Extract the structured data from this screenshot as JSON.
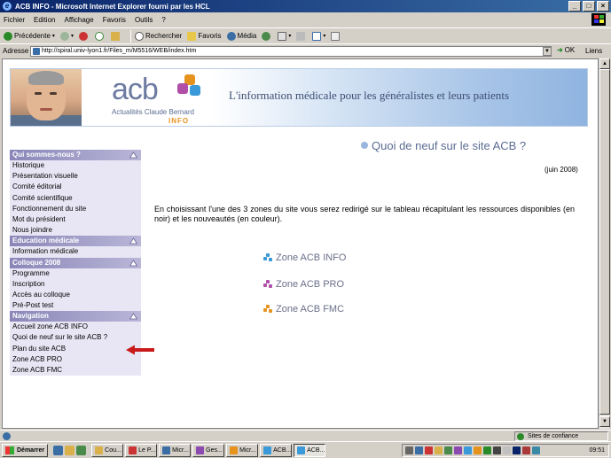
{
  "window": {
    "title": "ACB INFO - Microsoft Internet Explorer fourni par les HCL"
  },
  "menubar": [
    "Fichier",
    "Edition",
    "Affichage",
    "Favoris",
    "Outils",
    "?"
  ],
  "toolbar": {
    "back": "Précédente",
    "search": "Rechercher",
    "favorites": "Favoris",
    "media": "Média"
  },
  "address": {
    "label": "Adresse",
    "url": "http://spiral.univ-lyon1.fr/Files_m/M5516/WEB/index.htm",
    "go": "OK",
    "links": "Liens"
  },
  "banner": {
    "logo": "acb",
    "logo_sub": "Actualités Claude Bernard",
    "logo_info": "INFO",
    "tagline": "L'information médicale pour les généralistes et leurs patients"
  },
  "sidebar": {
    "sections": [
      {
        "title": "Qui sommes-nous ?",
        "items": [
          "Historique",
          "Présentation visuelle",
          "Comité éditorial",
          "Comité scientifique",
          "Fonctionnement du site",
          "Mot du président",
          "Nous joindre"
        ]
      },
      {
        "title": "Education médicale",
        "items": [
          "Information médicale"
        ]
      },
      {
        "title": "Colloque 2008",
        "items": [
          "Programme",
          "Inscription",
          "Accès au colloque",
          "Pré-Post test"
        ]
      },
      {
        "title": "Navigation",
        "items": [
          "Accueil zone ACB INFO",
          "Quoi de neuf sur le site ACB ?",
          "Plan du site ACB",
          "Zone ACB PRO",
          "Zone ACB FMC"
        ]
      }
    ]
  },
  "main": {
    "title": "Quoi de neuf sur le site ACB ?",
    "date": "(juin 2008)",
    "intro": "En choisissant l'une des 3 zones du site vous serez redirigé sur le tableau récapitulant les ressources disponibles (en noir) et les nouveautés (en couleur).",
    "zones": [
      "Zone ACB INFO",
      "Zone ACB PRO",
      "Zone ACB FMC"
    ]
  },
  "statusbar": {
    "zone": "Sites de confiance"
  },
  "taskbar": {
    "start": "Démarrer",
    "tasks": [
      "Cou...",
      "Le P...",
      "Micr...",
      "Ges...",
      "Micr...",
      "ACB...",
      "ACB..."
    ],
    "clock": "09:51"
  },
  "colors": {
    "acb_orange": "#e6931e",
    "acb_purple": "#b04ea8",
    "acb_blue": "#3a9ad9",
    "sidebar_head": "#8a86b8",
    "title_bar": "#0a246a"
  }
}
